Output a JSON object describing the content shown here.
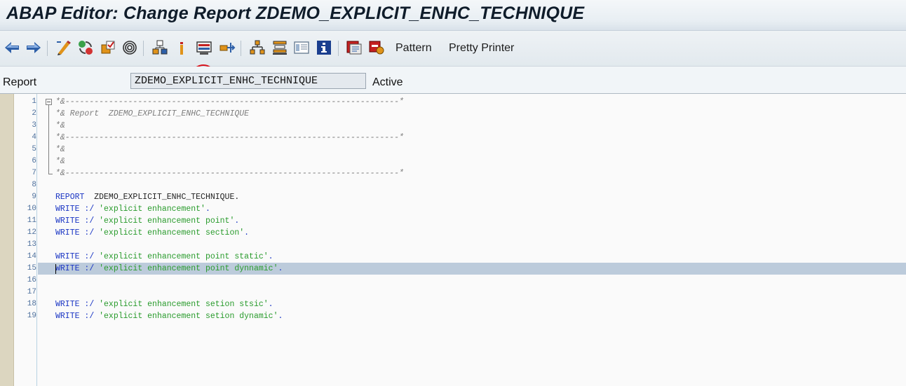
{
  "window": {
    "title": "ABAP Editor: Change Report ZDEMO_EXPLICIT_ENHC_TECHNIQUE"
  },
  "toolbar": {
    "pattern_label": "Pattern",
    "pretty_printer_label": "Pretty Printer",
    "highlighted_button": "enhance-icon",
    "colors": {
      "highlight_circle": "#d8121b",
      "icon_blue": "#2d5fa8",
      "icon_orange": "#e0931a"
    }
  },
  "report": {
    "label": "Report",
    "name": "ZDEMO_EXPLICIT_ENHC_TECHNIQUE",
    "status": "Active"
  },
  "editor": {
    "selected_line": 15,
    "colors": {
      "keyword": "#1a35c4",
      "string": "#299b2c",
      "comment": "#7d7d7d",
      "selection": "#bccbdb"
    },
    "lines": [
      {
        "num": "1",
        "kind": "comment",
        "text": "*&---------------------------------------------------------------------*"
      },
      {
        "num": "2",
        "kind": "comment",
        "text": "*& Report  ZDEMO_EXPLICIT_ENHC_TECHNIQUE"
      },
      {
        "num": "3",
        "kind": "comment",
        "text": "*&"
      },
      {
        "num": "4",
        "kind": "comment",
        "text": "*&---------------------------------------------------------------------*"
      },
      {
        "num": "5",
        "kind": "comment",
        "text": "*&"
      },
      {
        "num": "6",
        "kind": "comment",
        "text": "*&"
      },
      {
        "num": "7",
        "kind": "comment",
        "text": "*&---------------------------------------------------------------------*"
      },
      {
        "num": "8",
        "kind": "blank",
        "text": ""
      },
      {
        "num": "9",
        "kind": "report",
        "keyword": "REPORT",
        "rest": "  ZDEMO_EXPLICIT_ENHC_TECHNIQUE."
      },
      {
        "num": "10",
        "kind": "write",
        "keyword": "WRITE",
        "op": " :/ ",
        "string": "'explicit enhancement'",
        "end": "."
      },
      {
        "num": "11",
        "kind": "write",
        "keyword": "WRITE",
        "op": " :/ ",
        "string": "'explicit enhancement point'",
        "end": "."
      },
      {
        "num": "12",
        "kind": "write",
        "keyword": "WRITE",
        "op": " :/ ",
        "string": "'explicit enhancement section'",
        "end": "."
      },
      {
        "num": "13",
        "kind": "blank",
        "text": ""
      },
      {
        "num": "14",
        "kind": "write",
        "keyword": "WRITE",
        "op": " :/ ",
        "string": "'explicit enhancement point static'",
        "end": "."
      },
      {
        "num": "15",
        "kind": "write",
        "keyword": "WRITE",
        "op": " :/ ",
        "string": "'explicit enhancement point dynnamic'",
        "end": "."
      },
      {
        "num": "16",
        "kind": "blank",
        "text": ""
      },
      {
        "num": "17",
        "kind": "blank",
        "text": ""
      },
      {
        "num": "18",
        "kind": "write",
        "keyword": "WRITE",
        "op": " :/ ",
        "string": "'explicit enhancement setion stsic'",
        "end": "."
      },
      {
        "num": "19",
        "kind": "write",
        "keyword": "WRITE",
        "op": " :/ ",
        "string": "'explicit enhancement setion dynamic'",
        "end": "."
      }
    ]
  }
}
